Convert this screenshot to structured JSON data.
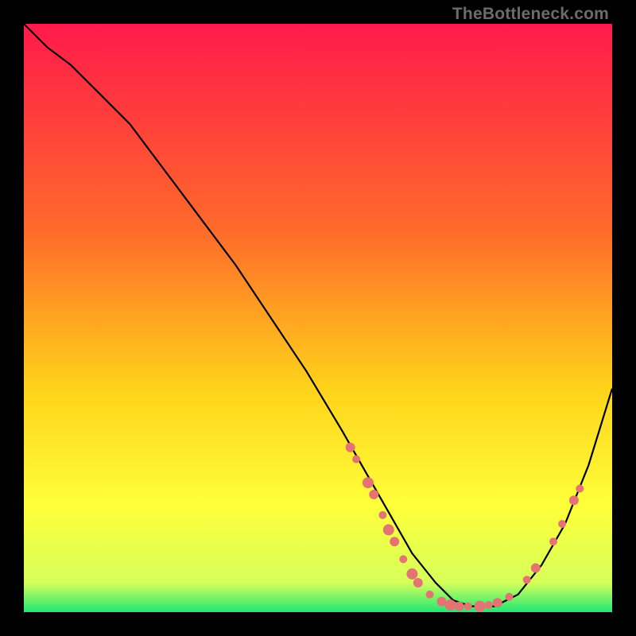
{
  "watermark": "TheBottleneck.com",
  "chart_data": {
    "type": "line",
    "title": "",
    "xlabel": "",
    "ylabel": "",
    "xlim": [
      0,
      100
    ],
    "ylim": [
      0,
      100
    ],
    "grid": false,
    "legend": false,
    "gradient_stops": [
      {
        "offset": 0,
        "color": "#ff1a4b"
      },
      {
        "offset": 35,
        "color": "#ff6a2a"
      },
      {
        "offset": 62,
        "color": "#ffd31a"
      },
      {
        "offset": 82,
        "color": "#ffff3a"
      },
      {
        "offset": 95,
        "color": "#d6ff5a"
      },
      {
        "offset": 100,
        "color": "#20e874"
      }
    ],
    "series": [
      {
        "name": "bottleneck-curve",
        "color": "#000000",
        "x": [
          0,
          4,
          8,
          12,
          18,
          24,
          30,
          36,
          42,
          48,
          54,
          58,
          62,
          66,
          70,
          73,
          76,
          80,
          84,
          88,
          92,
          96,
          100
        ],
        "y": [
          100,
          96,
          93,
          89,
          83,
          75,
          67,
          59,
          50,
          41,
          31,
          24,
          17,
          10,
          5,
          2,
          1,
          1,
          3,
          8,
          15,
          25,
          38
        ]
      }
    ],
    "scatter": {
      "name": "marker-dots",
      "color": "#e57373",
      "radius_small": 5,
      "radius_large": 7,
      "points": [
        {
          "x": 55.5,
          "y": 28,
          "r": 6
        },
        {
          "x": 56.5,
          "y": 26,
          "r": 5
        },
        {
          "x": 58.5,
          "y": 22,
          "r": 7
        },
        {
          "x": 59.5,
          "y": 20,
          "r": 6
        },
        {
          "x": 61.0,
          "y": 16.5,
          "r": 5
        },
        {
          "x": 62.0,
          "y": 14,
          "r": 7
        },
        {
          "x": 63.0,
          "y": 12,
          "r": 6
        },
        {
          "x": 64.5,
          "y": 9,
          "r": 5
        },
        {
          "x": 66.0,
          "y": 6.5,
          "r": 7
        },
        {
          "x": 67.0,
          "y": 5,
          "r": 6
        },
        {
          "x": 69.0,
          "y": 3,
          "r": 5
        },
        {
          "x": 71.0,
          "y": 1.8,
          "r": 6
        },
        {
          "x": 72.5,
          "y": 1.2,
          "r": 7
        },
        {
          "x": 74.0,
          "y": 1.0,
          "r": 6
        },
        {
          "x": 75.5,
          "y": 1.0,
          "r": 5
        },
        {
          "x": 77.5,
          "y": 1.0,
          "r": 7
        },
        {
          "x": 79.0,
          "y": 1.2,
          "r": 5
        },
        {
          "x": 80.5,
          "y": 1.6,
          "r": 6
        },
        {
          "x": 82.5,
          "y": 2.6,
          "r": 5
        },
        {
          "x": 85.5,
          "y": 5.5,
          "r": 5
        },
        {
          "x": 87.0,
          "y": 7.5,
          "r": 6
        },
        {
          "x": 90.0,
          "y": 12,
          "r": 5
        },
        {
          "x": 91.5,
          "y": 15,
          "r": 5
        },
        {
          "x": 93.5,
          "y": 19,
          "r": 6
        },
        {
          "x": 94.5,
          "y": 21,
          "r": 5
        }
      ]
    }
  }
}
